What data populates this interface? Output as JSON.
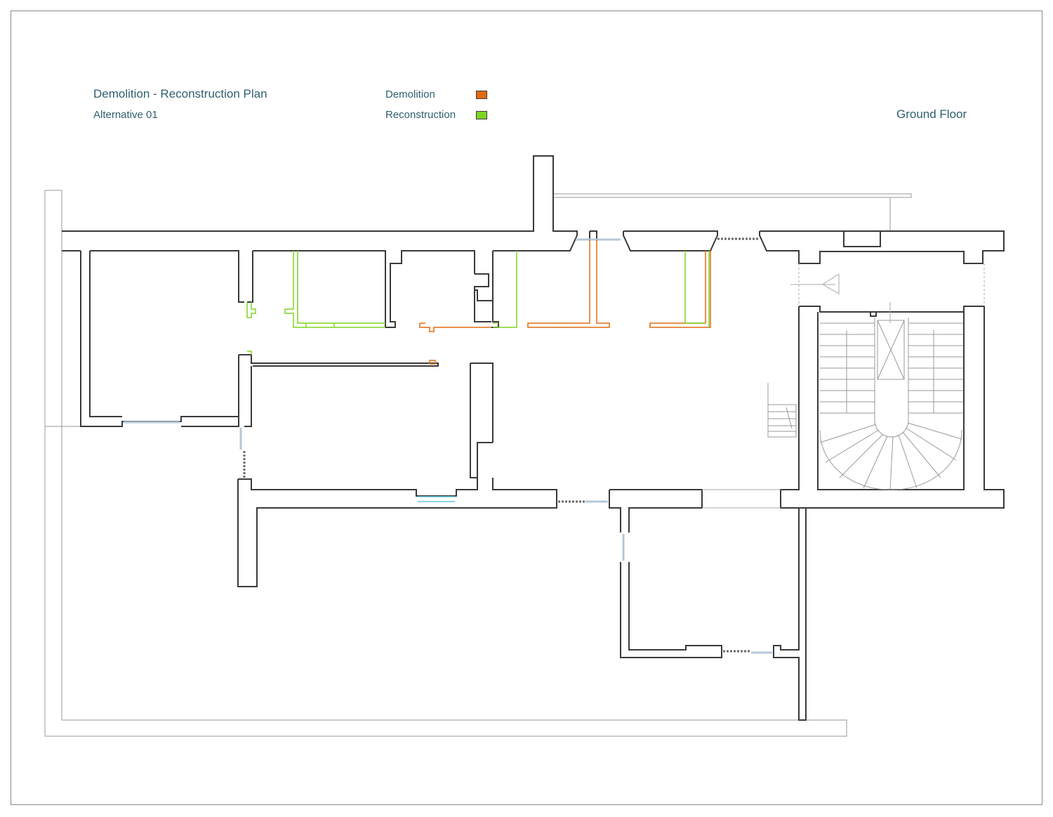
{
  "header": {
    "title": "Demolition - Reconstruction Plan",
    "subtitle": "Alternative 01",
    "floor_label": "Ground Floor"
  },
  "legend": {
    "items": [
      {
        "label": "Demolition",
        "color": "#e06b10"
      },
      {
        "label": "Reconstruction",
        "color": "#7ed321"
      }
    ]
  },
  "colors": {
    "wall": "#3a3a3a",
    "thin_line": "#9a9a9a",
    "window": "#b5c8d8",
    "text": "#2f5f6e",
    "demolition": "#e06b10",
    "reconstruction": "#7ed321"
  }
}
